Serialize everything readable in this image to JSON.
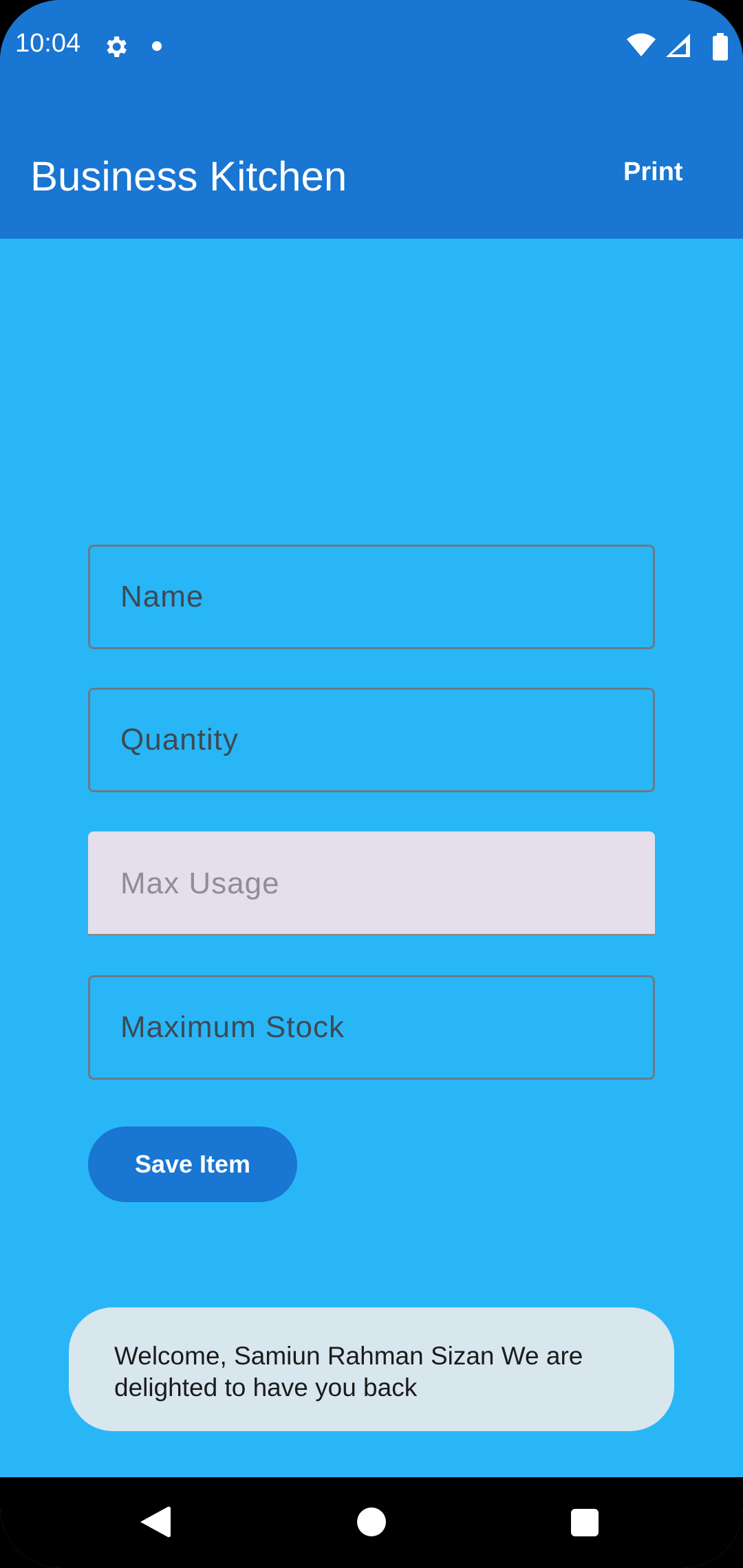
{
  "status_bar": {
    "time": "10:04",
    "icons": [
      "gear-icon",
      "notification-dot-icon",
      "wifi-icon",
      "signal-icon",
      "battery-icon"
    ]
  },
  "app_bar": {
    "title": "Business Kitchen",
    "print_label": "Print"
  },
  "form": {
    "fields": [
      {
        "placeholder": "Name",
        "value": ""
      },
      {
        "placeholder": "Quantity",
        "value": ""
      },
      {
        "placeholder": "Max Usage",
        "value": ""
      },
      {
        "placeholder": "Maximum Stock",
        "value": ""
      }
    ],
    "save_label": "Save Item"
  },
  "toast": {
    "message": "Welcome, Samiun Rahman Sizan We are delighted to have you back"
  },
  "nav_bar": {
    "icons": [
      "back-icon",
      "home-icon",
      "recents-icon"
    ]
  },
  "colors": {
    "app_bar": "#1976D2",
    "background": "#29B6F6",
    "field_filled": "#E5DEEB",
    "toast": "#D8E6EE"
  }
}
